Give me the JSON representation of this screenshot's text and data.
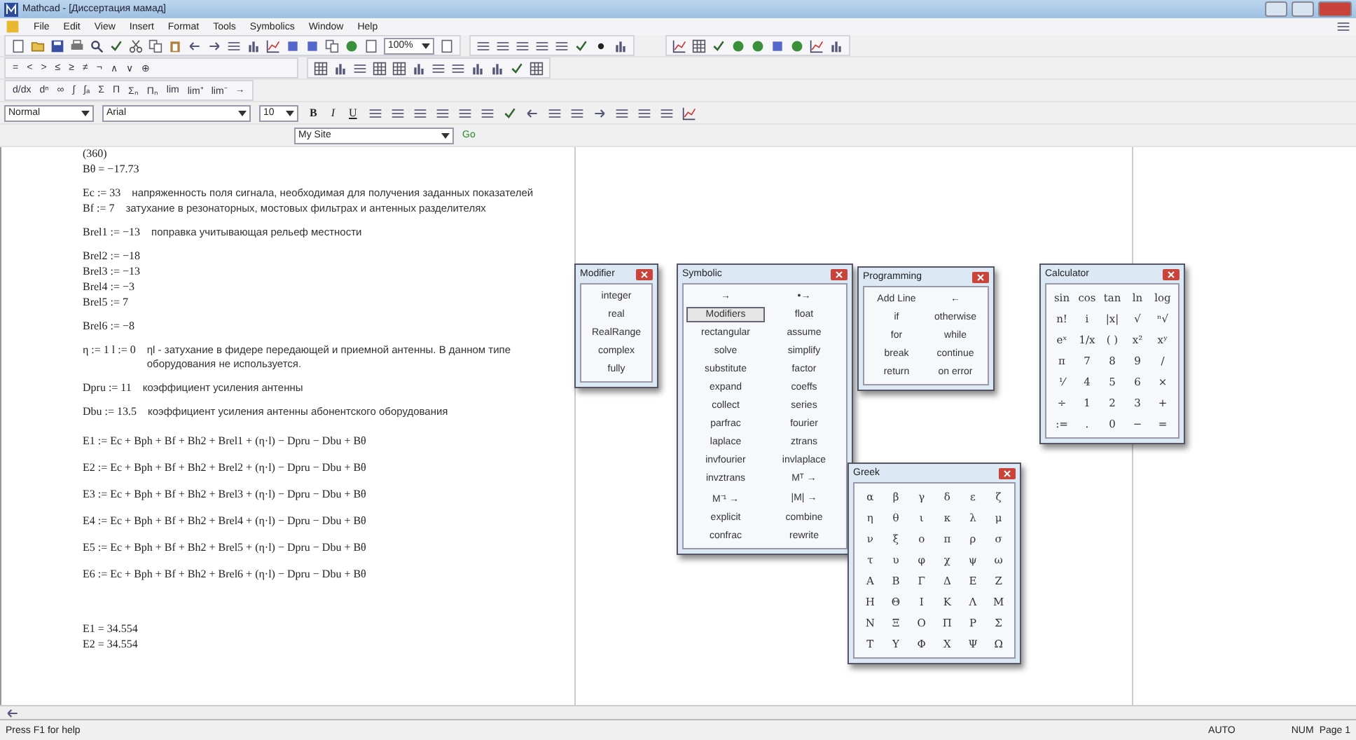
{
  "window": {
    "title": "Mathcad - [Диссертация мамад]"
  },
  "menu": [
    "File",
    "Edit",
    "View",
    "Insert",
    "Format",
    "Tools",
    "Symbolics",
    "Window",
    "Help"
  ],
  "zoom": "100%",
  "boolean_toolbar": [
    "=",
    "<",
    ">",
    "≤",
    "≥",
    "≠",
    "¬",
    "∧",
    "∨",
    "⊕"
  ],
  "calculus_toolbar": [
    "d/dx",
    "dⁿ",
    "∞",
    "∫",
    "∫ₐ",
    "Σ",
    "Π",
    "Σₙ",
    "Πₙ",
    "lim",
    "lim⁺",
    "lim⁻",
    "→"
  ],
  "format_bar": {
    "style": "Normal",
    "font": "Arial",
    "size": "10",
    "buttons": [
      "B",
      "I",
      "U"
    ]
  },
  "web_bar": {
    "address": "My Site",
    "go": "Go"
  },
  "worksheet": {
    "blocks": [
      {
        "kind": "tight",
        "lines": [
          {
            "expr": "(360)"
          },
          {
            "expr": "Bθ = −17.73"
          }
        ]
      },
      {
        "kind": "tight",
        "lines": [
          {
            "expr": "Ec := 33",
            "comment": "напряженность поля сигнала, необходимая для получения заданных показателей"
          },
          {
            "expr": "Bf := 7",
            "comment": "затухание в резонаторных, мостовых фильтрах и антенных разделителях"
          }
        ]
      },
      {
        "kind": "tight",
        "lines": [
          {
            "expr": "Brel1 := −13",
            "comment": "поправка учитывающая рельеф местности"
          }
        ]
      },
      {
        "kind": "tight",
        "lines": [
          {
            "expr": "Brel2 := −18"
          },
          {
            "expr": "Brel3 := −13"
          },
          {
            "expr": "Brel4 := −3"
          },
          {
            "expr": "Brel5 := 7"
          }
        ]
      },
      {
        "kind": "tight",
        "lines": [
          {
            "expr": "Brel6 := −8"
          }
        ]
      },
      {
        "kind": "tight",
        "lines": [
          {
            "expr": "η := 1   l := 0",
            "comment": "ηl - затухание в фидере передающей и приемной антенны. В данном типе оборудования не используется."
          }
        ]
      },
      {
        "kind": "tight",
        "lines": [
          {
            "expr": "Dpru := 11",
            "comment": "коэффициент усиления антенны"
          }
        ]
      },
      {
        "kind": "tight",
        "lines": [
          {
            "expr": "Dbu := 13.5",
            "comment": "коэффициент усиления антенны абонентского оборудования"
          }
        ]
      },
      {
        "kind": "spaced",
        "lines": [
          {
            "expr": "E1 := Ec + Bph + Bf + Bh2 + Brel1 + (η·l) − Dpru − Dbu + Bθ"
          },
          {
            "expr": "E2 := Ec + Bph + Bf + Bh2 + Brel2 + (η·l) − Dpru − Dbu + Bθ"
          },
          {
            "expr": "E3 := Ec + Bph + Bf + Bh2 + Brel3 + (η·l) − Dpru − Dbu + Bθ"
          },
          {
            "expr": "E4 := Ec + Bph + Bf + Bh2 + Brel4 + (η·l) − Dpru − Dbu + Bθ"
          },
          {
            "expr": "E5 := Ec + Bph + Bf + Bh2 + Brel5 + (η·l) − Dpru − Dbu + Bθ"
          },
          {
            "expr": "E6 := Ec + Bph + Bf + Bh2 + Brel6 + (η·l) − Dpru − Dbu + Bθ"
          }
        ]
      },
      {
        "kind": "results",
        "lines": [
          {
            "expr": "E1 = 34.554"
          },
          {
            "expr": "E2 = 34.554"
          }
        ]
      }
    ]
  },
  "palettes": [
    {
      "title": "Modifier",
      "kind": "list",
      "items": [
        "integer",
        "real",
        "RealRange",
        "complex",
        "fully"
      ]
    },
    {
      "title": "Symbolic",
      "kind": "two-column",
      "items": [
        {
          "label": "→",
          "selected": false
        },
        {
          "label": "•→",
          "selected": false
        },
        {
          "label": "Modifiers",
          "selected": true
        },
        {
          "label": "float",
          "selected": false
        },
        {
          "label": "rectangular",
          "selected": false
        },
        {
          "label": "assume",
          "selected": false
        },
        {
          "label": "solve",
          "selected": false
        },
        {
          "label": "simplify",
          "selected": false
        },
        {
          "label": "substitute",
          "selected": false
        },
        {
          "label": "factor",
          "selected": false
        },
        {
          "label": "expand",
          "selected": false
        },
        {
          "label": "coeffs",
          "selected": false
        },
        {
          "label": "collect",
          "selected": false
        },
        {
          "label": "series",
          "selected": false
        },
        {
          "label": "parfrac",
          "selected": false
        },
        {
          "label": "fourier",
          "selected": false
        },
        {
          "label": "laplace",
          "selected": false
        },
        {
          "label": "ztrans",
          "selected": false
        },
        {
          "label": "invfourier",
          "selected": false
        },
        {
          "label": "invlaplace",
          "selected": false
        },
        {
          "label": "invztrans",
          "selected": false
        },
        {
          "label": "Mᵀ →",
          "selected": false
        },
        {
          "label": "M⁻¹ →",
          "selected": false
        },
        {
          "label": "|M| →",
          "selected": false
        },
        {
          "label": "explicit",
          "selected": false
        },
        {
          "label": "combine",
          "selected": false
        },
        {
          "label": "confrac",
          "selected": false
        },
        {
          "label": "rewrite",
          "selected": false
        }
      ]
    },
    {
      "title": "Programming",
      "kind": "two-column",
      "items": [
        "Add Line",
        "←",
        "if",
        "otherwise",
        "for",
        "while",
        "break",
        "continue",
        "return",
        "on error"
      ]
    },
    {
      "title": "Calculator",
      "kind": "grid5",
      "items": [
        "sin",
        "cos",
        "tan",
        "ln",
        "log",
        "n!",
        "i",
        "|x|",
        "√",
        "ⁿ√",
        "eˣ",
        "1/x",
        "( )",
        "x²",
        "xʸ",
        "π",
        "7",
        "8",
        "9",
        "/",
        "⅟",
        "4",
        "5",
        "6",
        "×",
        "÷",
        "1",
        "2",
        "3",
        "+",
        ":=",
        ".",
        "0",
        "−",
        "="
      ]
    },
    {
      "title": "Greek",
      "kind": "grid6",
      "items": [
        "α",
        "β",
        "γ",
        "δ",
        "ε",
        "ζ",
        "η",
        "θ",
        "ι",
        "κ",
        "λ",
        "μ",
        "ν",
        "ξ",
        "ο",
        "π",
        "ρ",
        "σ",
        "τ",
        "υ",
        "φ",
        "χ",
        "ψ",
        "ω",
        "Α",
        "Β",
        "Γ",
        "Δ",
        "Ε",
        "Ζ",
        "Η",
        "Θ",
        "Ι",
        "Κ",
        "Λ",
        "Μ",
        "Ν",
        "Ξ",
        "Ο",
        "Π",
        "Ρ",
        "Σ",
        "Τ",
        "Υ",
        "Φ",
        "Χ",
        "Ψ",
        "Ω"
      ]
    }
  ],
  "status_bar": {
    "help": "Press F1 for help",
    "mode": "AUTO",
    "keys": "NUM",
    "page": "Page 1"
  }
}
